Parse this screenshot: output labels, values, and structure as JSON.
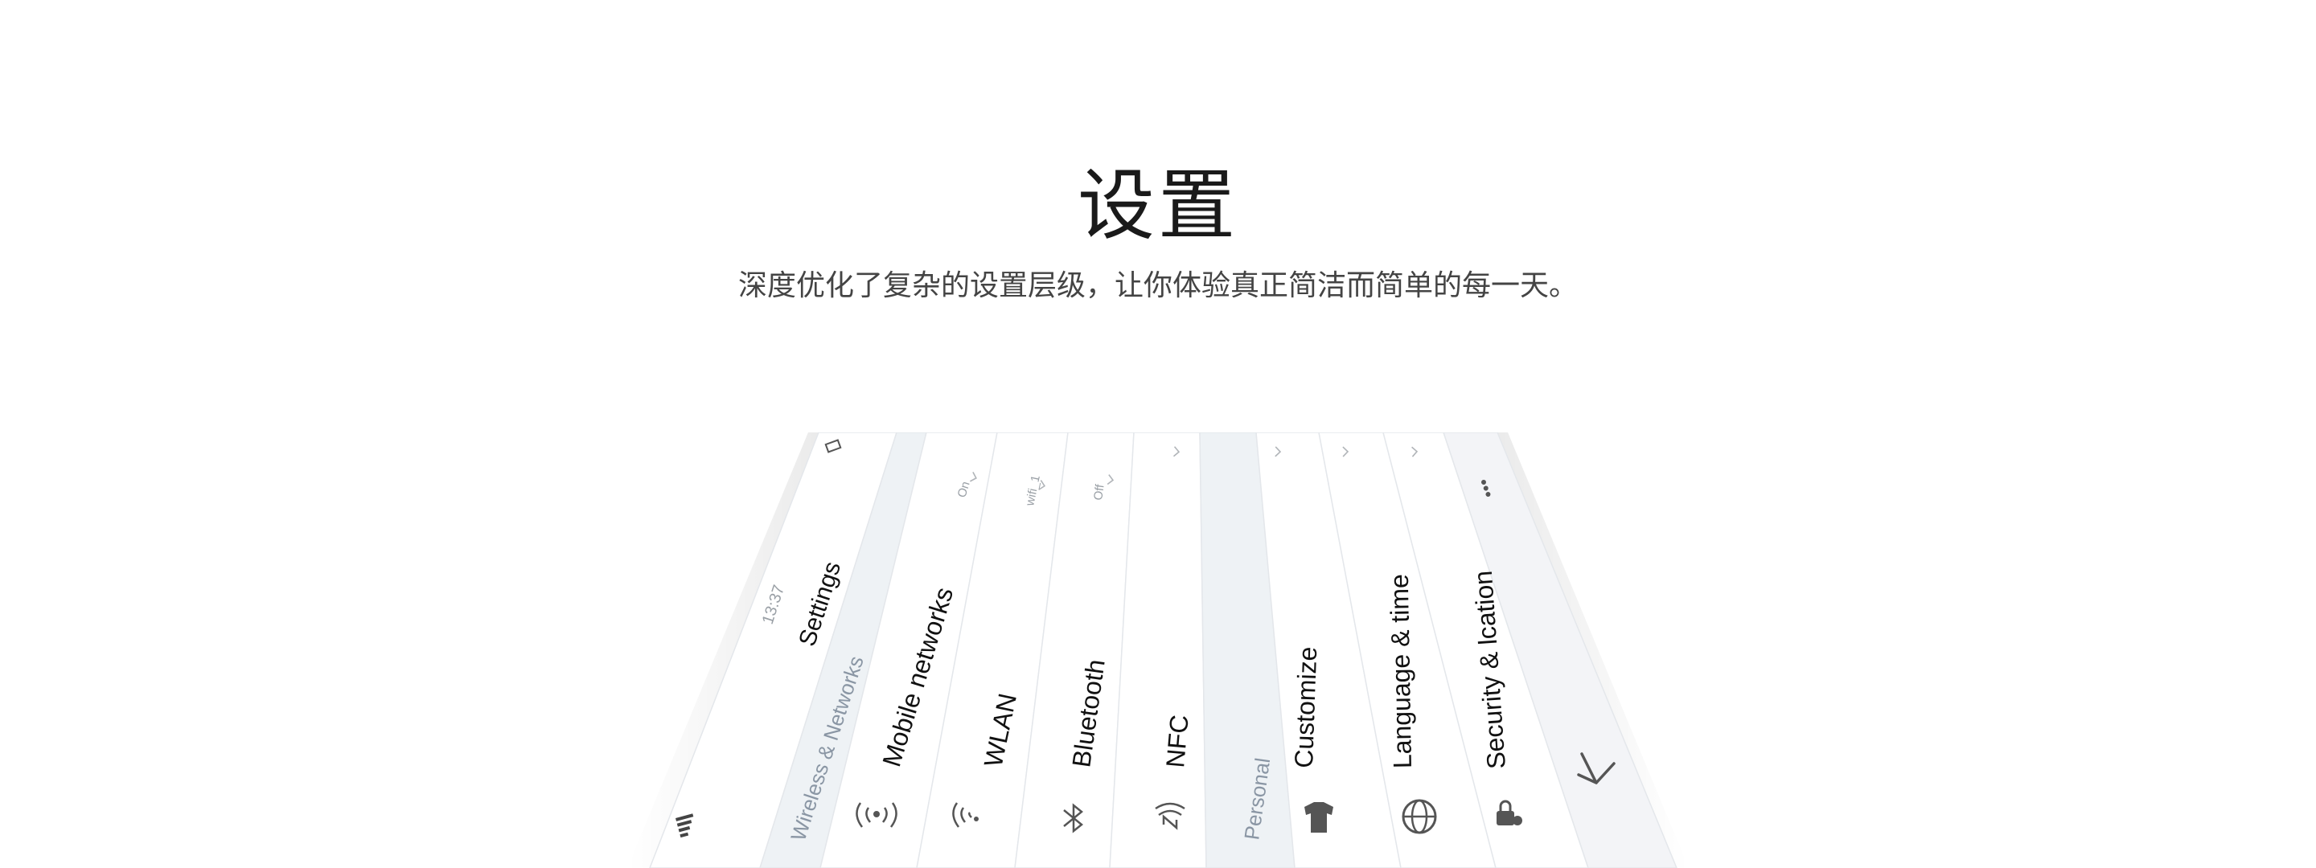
{
  "page": {
    "title": "设置",
    "subtitle": "深度优化了复杂的设置层级，让你体验真正简洁而简单的每一天。"
  },
  "phone": {
    "status_time": "13:37",
    "screen_title": "Settings",
    "sections": [
      {
        "header": "Wireless & Networks",
        "items": [
          {
            "label": "Mobile networks",
            "value": "On",
            "icon": "mobile-network-icon"
          },
          {
            "label": "WLAN",
            "value": "wifi_1",
            "icon": "wifi-icon"
          },
          {
            "label": "Bluetooth",
            "value": "Off",
            "icon": "bluetooth-icon"
          },
          {
            "label": "NFC",
            "value": "",
            "icon": "nfc-icon"
          }
        ]
      },
      {
        "header": "Personal",
        "items": [
          {
            "label": "Customize",
            "value": "",
            "icon": "tshirt-icon"
          },
          {
            "label": "Language & time",
            "value": "",
            "icon": "globe-icon"
          },
          {
            "label": "Security & lcation",
            "value": "",
            "icon": "lock-location-icon"
          }
        ]
      }
    ],
    "more_icon": "more-dots-icon",
    "back_icon": "back-arrow-icon",
    "colors": {
      "section_bg": "#eef2f5",
      "row_bg": "#ffffff",
      "nav_bg": "#f3f4f7",
      "divider": "#e4e7eb"
    }
  }
}
